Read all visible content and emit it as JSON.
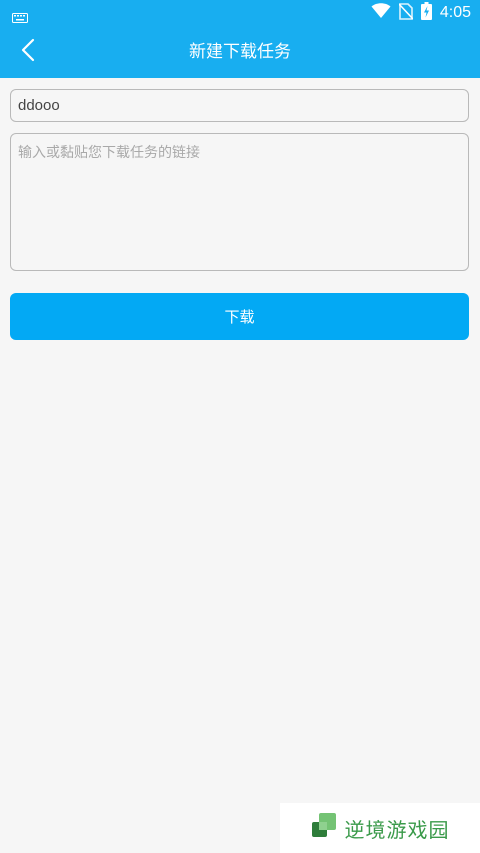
{
  "status_bar": {
    "time": "4:05",
    "icons": [
      "keyboard-icon",
      "wifi-icon",
      "no-sim-icon",
      "battery-charging-icon"
    ]
  },
  "header": {
    "title": "新建下载任务",
    "back_icon": "chevron-left-icon"
  },
  "form": {
    "name_value": "ddooo",
    "url_placeholder": "输入或黏贴您下载任务的链接",
    "url_value": "",
    "download_label": "下载"
  },
  "watermark": {
    "text": "逆境游戏园"
  },
  "colors": {
    "primary": "#18aef0",
    "button": "#03a9f4",
    "background": "#f6f6f6",
    "watermark_green": "#3a9a4a"
  }
}
